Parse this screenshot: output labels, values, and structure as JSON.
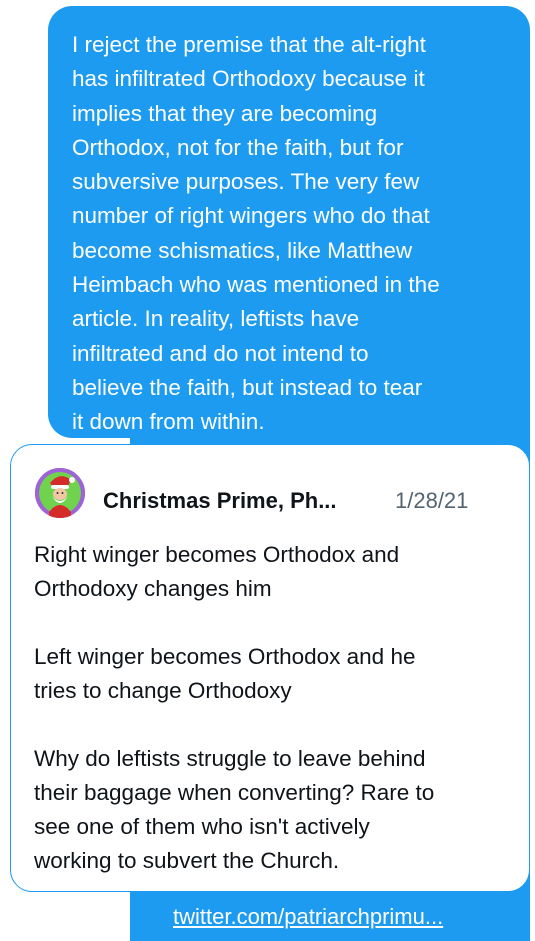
{
  "message": {
    "text": "I reject the premise that the alt-right\nhas infiltrated Orthodoxy because it\nimplies that they are becoming\nOrthodox, not for the faith, but for\nsubversive purposes. The very few\nnumber of right wingers who do that\nbecome schismatics, like Matthew\nHeimbach who was mentioned in the\narticle. In reality, leftists have\ninfiltrated and do not intend to\nbelieve the faith, but instead to tear\nit down from within."
  },
  "quoted_tweet": {
    "author_name": "Christmas Prime, Ph...",
    "date": "1/28/21",
    "avatar_icon": "santa-avatar-icon",
    "body": "Right winger becomes Orthodox and\nOrthodoxy changes him\n\nLeft winger becomes Orthodox and he\ntries to change Orthodoxy\n\nWhy do leftists struggle to leave behind\ntheir baggage when converting? Rare to\nsee one of them who isn't actively\nworking to subvert the Church."
  },
  "link": {
    "text": "twitter.com/patriarchprimu..."
  },
  "colors": {
    "bubble": "#1d9bf0",
    "text_primary": "#0f1419",
    "text_secondary": "#536471"
  }
}
